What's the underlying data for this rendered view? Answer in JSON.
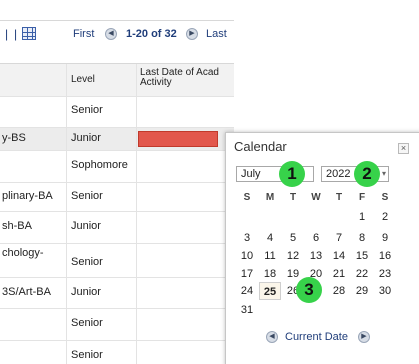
{
  "pager": {
    "separator": "|",
    "separator2": "|",
    "first_label": "First",
    "prev_glyph": "◀",
    "range_label": "1-20 of 32",
    "next_glyph": "▶",
    "last_label": "Last"
  },
  "table": {
    "headers": {
      "level": "Level",
      "last_date": "Last Date of Acad Activity"
    },
    "rows": [
      {
        "program": "",
        "level": "Senior"
      },
      {
        "program": "y-BS",
        "level": "Junior"
      },
      {
        "program": "",
        "level": "Sophomore"
      },
      {
        "program": "plinary-BA",
        "level": "Senior"
      },
      {
        "program": "sh-BA",
        "level": "Junior"
      },
      {
        "program": "chology-",
        "level": "Senior"
      },
      {
        "program": "3S/Art-BA",
        "level": "Junior"
      },
      {
        "program": "",
        "level": "Senior"
      },
      {
        "program": "",
        "level": "Senior"
      }
    ],
    "error_color": "#e2574c"
  },
  "calendar": {
    "title": "Calendar",
    "close_glyph": "×",
    "month": "July",
    "year": "2022",
    "year_arrow": "▾",
    "weekdays": [
      "S",
      "M",
      "T",
      "W",
      "T",
      "F",
      "S"
    ],
    "weeks": [
      [
        "",
        "",
        "",
        "",
        "",
        "1",
        "2"
      ],
      [
        "3",
        "4",
        "5",
        "6",
        "7",
        "8",
        "9"
      ],
      [
        "10",
        "11",
        "12",
        "13",
        "14",
        "15",
        "16"
      ],
      [
        "17",
        "18",
        "19",
        "20",
        "21",
        "22",
        "23"
      ],
      [
        "24",
        "25",
        "26",
        "27",
        "28",
        "29",
        "30"
      ],
      [
        "31",
        "",
        "",
        "",
        "",
        "",
        ""
      ]
    ],
    "today": "25",
    "footer_prev_glyph": "◀",
    "current_date_label": "Current Date",
    "footer_next_glyph": "▶"
  },
  "markers": {
    "m1": "1",
    "m2": "2",
    "m3": "3",
    "color": "#37d24a"
  }
}
